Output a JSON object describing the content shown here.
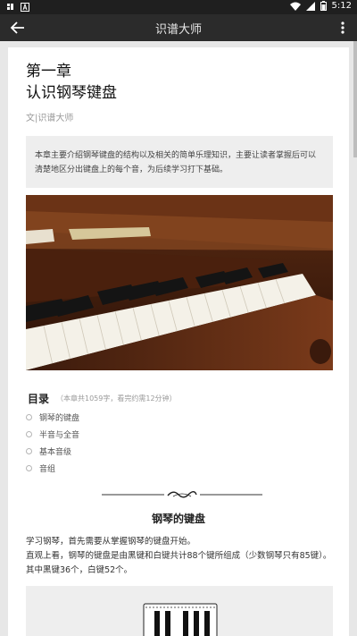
{
  "status_bar": {
    "time": "5:12",
    "notification_icons": [
      "app-notification-icon",
      "a-letter-icon"
    ],
    "system_icons": [
      "wifi-icon",
      "signal-icon",
      "battery-icon"
    ]
  },
  "app_bar": {
    "title": "识谱大师"
  },
  "article": {
    "chapter": "第一章",
    "title": "认识钢琴键盘",
    "author": "文|识谱大师",
    "summary": "本章主要介绍钢琴键盘的结构以及相关的简单乐理知识，主要让读者掌握后可以清楚地区分出键盘上的每个音，为后续学习打下基础。",
    "toc": {
      "title": "目录",
      "meta": "（本章共1059字，看完约需12分钟）",
      "items": [
        "钢琴的键盘",
        "半音与全音",
        "基本音级",
        "音组"
      ]
    },
    "section": {
      "title": "钢琴的键盘",
      "paragraphs": [
        "学习钢琴，首先需要从掌握钢琴的键盘开始。",
        "直观上看，钢琴的键盘是由黑键和白键共计88个键所组成（少数钢琴只有85键）。其中黑键36个，白键52个。"
      ]
    }
  },
  "colors": {
    "status_bar_bg": "#1f1f1f",
    "app_bar_bg": "#2b2b2b",
    "page_bg": "#ffffff",
    "summary_bg": "#eeeeee"
  }
}
